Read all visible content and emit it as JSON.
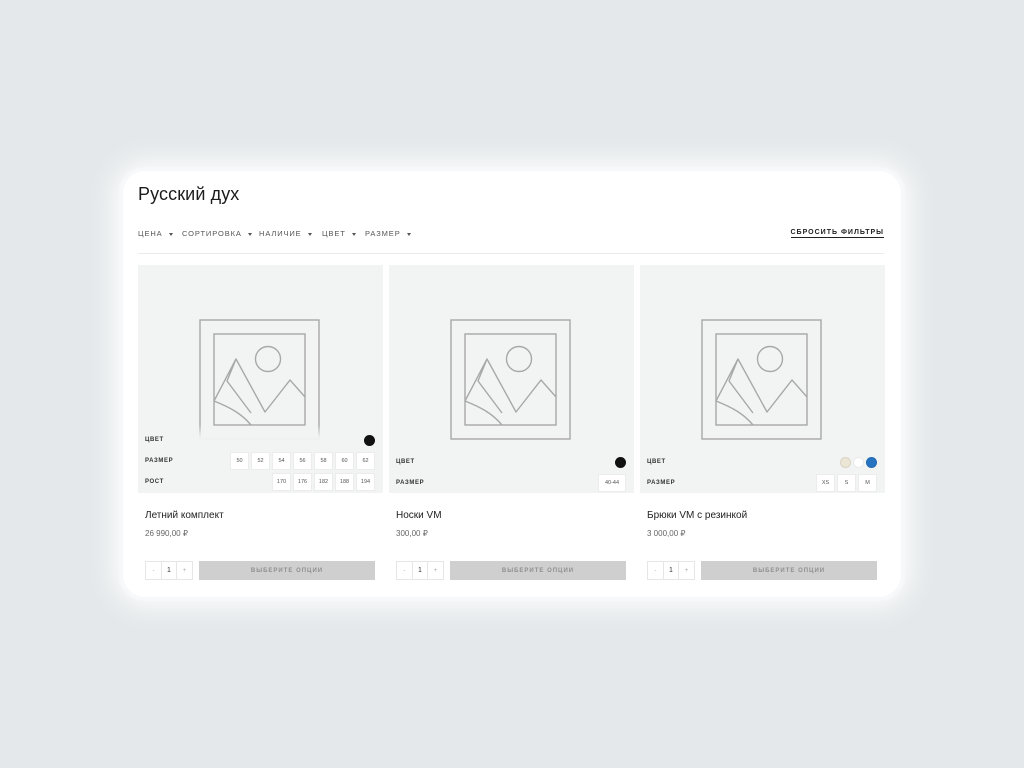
{
  "page": {
    "title": "Русский дух"
  },
  "filters": {
    "items": [
      {
        "label": "ЦЕНА"
      },
      {
        "label": "СОРТИРОВКА"
      },
      {
        "label": "НАЛИЧИЕ"
      },
      {
        "label": "ЦВЕТ"
      },
      {
        "label": "РАЗМЕР"
      }
    ],
    "reset_label": "СБРОСИТЬ ФИЛЬТРЫ"
  },
  "icons": {
    "image_placeholder": "image-placeholder-icon",
    "caret": "caret-down-icon"
  },
  "products": [
    {
      "name": "Летний комплект",
      "price": "26 990,00 ₽",
      "quantity": "1",
      "button_label": "ВЫБЕРИТЕ ОПЦИИ",
      "qty_minus": "-",
      "qty_plus": "+",
      "options": {
        "color_label": "ЦВЕТ",
        "colors": [
          "#111111"
        ],
        "size_label": "РАЗМЕР",
        "sizes": [
          "50",
          "52",
          "54",
          "56",
          "58",
          "60",
          "62"
        ],
        "height_label": "РОСТ",
        "heights": [
          "170",
          "176",
          "182",
          "188",
          "194"
        ]
      }
    },
    {
      "name": "Носки VM",
      "price": "300,00 ₽",
      "quantity": "1",
      "button_label": "ВЫБЕРИТЕ ОПЦИИ",
      "qty_minus": "-",
      "qty_plus": "+",
      "options": {
        "color_label": "ЦВЕТ",
        "colors": [
          "#111111"
        ],
        "size_label": "РАЗМЕР",
        "sizes": [
          "40-44"
        ]
      }
    },
    {
      "name": "Брюки VM с резинкой",
      "price": "3 000,00 ₽",
      "quantity": "1",
      "button_label": "ВЫБЕРИТЕ ОПЦИИ",
      "qty_minus": "-",
      "qty_plus": "+",
      "options": {
        "color_label": "ЦВЕТ",
        "colors": [
          "#ece6d6",
          "#ffffff",
          "#2673c2"
        ],
        "size_label": "РАЗМЕР",
        "sizes": [
          "XS",
          "S",
          "M"
        ]
      }
    }
  ],
  "colors": {
    "background": "#e4e8ea",
    "card_image_bg": "#f2f4f3",
    "button_bg": "#cfcfcf",
    "button_text": "#8f8f8f"
  }
}
